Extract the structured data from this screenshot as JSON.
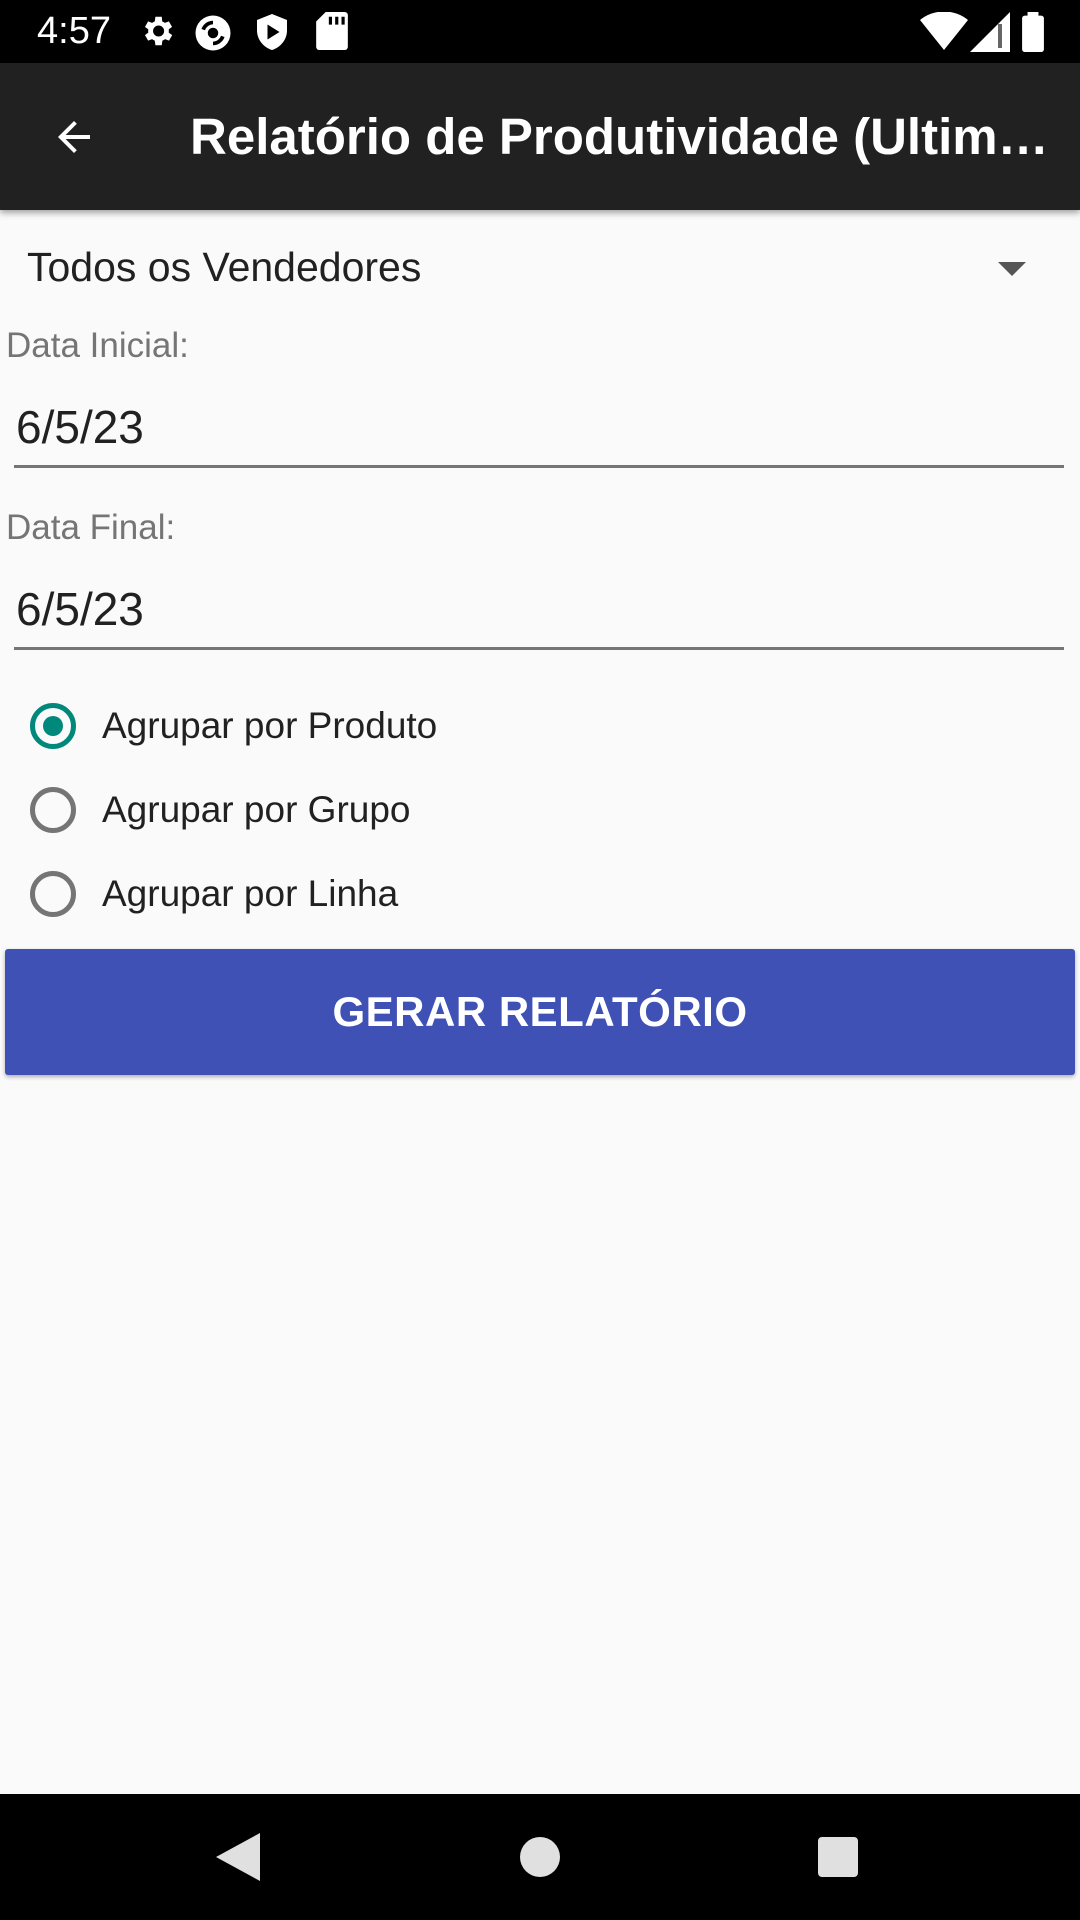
{
  "status_bar": {
    "time": "4:57",
    "left_icons": [
      "gear-icon",
      "sync-icon",
      "shield-icon",
      "sd-card-icon"
    ],
    "right_icons": [
      "wifi-icon",
      "signal-icon",
      "battery-icon"
    ]
  },
  "toolbar": {
    "title": "Relatório de Produtividade (Ultima…",
    "back_icon": "arrow-back-icon"
  },
  "form": {
    "seller_spinner": {
      "selected": "Todos os Vendedores"
    },
    "start_date": {
      "label": "Data Inicial:",
      "value": "6/5/23"
    },
    "end_date": {
      "label": "Data Final:",
      "value": "6/5/23"
    },
    "group_options": [
      {
        "label": "Agrupar por Produto",
        "checked": true
      },
      {
        "label": "Agrupar por Grupo",
        "checked": false
      },
      {
        "label": "Agrupar por Linha",
        "checked": false
      }
    ],
    "submit_label": "GERAR RELATÓRIO"
  },
  "nav_bar": {
    "buttons": [
      "back-triangle-icon",
      "home-circle-icon",
      "recents-square-icon"
    ]
  },
  "colors": {
    "toolbar": "#212121",
    "accent": "#00897b",
    "primary_button": "#3f51b5",
    "background": "#fafafa"
  }
}
